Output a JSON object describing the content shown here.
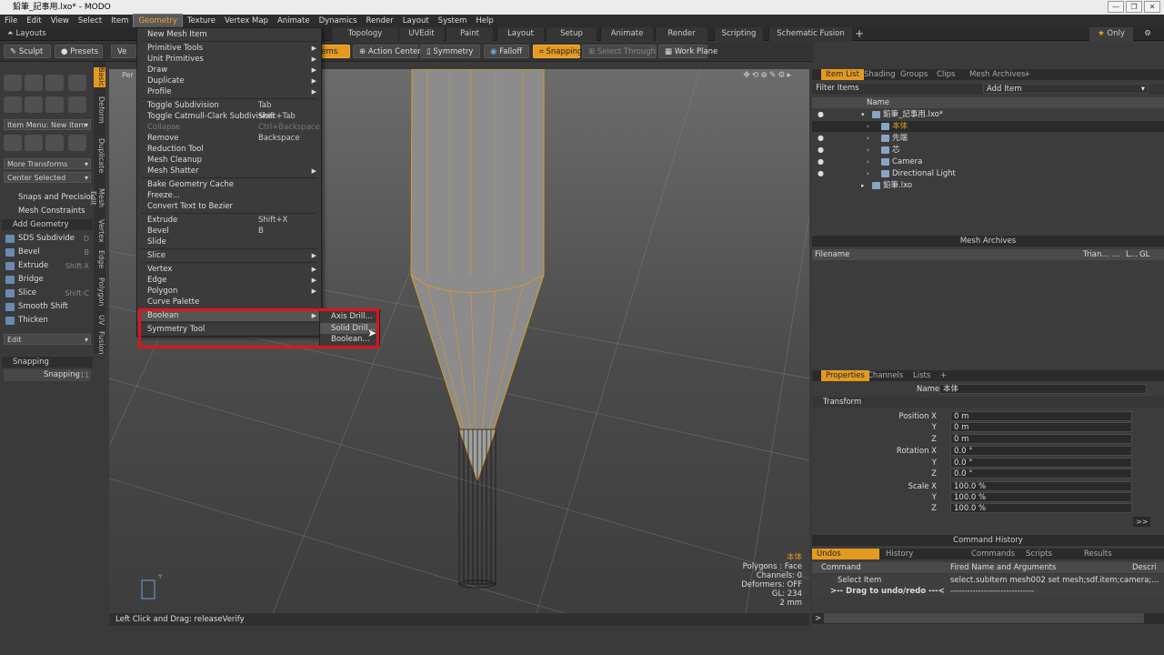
{
  "window": {
    "title": "鉛筆_記事用.lxo* - MODO",
    "min": "—",
    "restore": "❐",
    "close": "✕"
  },
  "menubar": [
    "File",
    "Edit",
    "View",
    "Select",
    "Item",
    "Geometry",
    "Texture",
    "Vertex Map",
    "Animate",
    "Dynamics",
    "Render",
    "Layout",
    "System",
    "Help"
  ],
  "layoutbar": {
    "label": "Layouts",
    "tabs": [
      "Topology",
      "UVEdit",
      "Paint",
      "Layout",
      "Setup",
      "Animate",
      "Render",
      "Scripting",
      "Schematic Fusion"
    ],
    "add": "+",
    "only_label": "Only"
  },
  "toolbar": {
    "sculpt": "Sculpt",
    "presets": "Presets",
    "ve": "Ve",
    "items": "tems",
    "action_center": "Action Center",
    "symmetry": "Symmetry",
    "falloff": "Falloff",
    "snapping": "Snapping",
    "select_through": "Select Through",
    "work_plane": "Work Plane"
  },
  "leftpanel": {
    "item_menu": "Item Menu: New Item",
    "more_transforms": "More Transforms",
    "center_selected": "Center Selected",
    "snaps": "Snaps and Precision",
    "mesh_constraints": "Mesh Constraints",
    "add_geometry": "Add Geometry",
    "tools": [
      {
        "label": "SDS Subdivide",
        "sc": "D"
      },
      {
        "label": "Bevel",
        "sc": "B"
      },
      {
        "label": "Extrude",
        "sc": "Shift-X"
      },
      {
        "label": "Bridge",
        "sc": ""
      },
      {
        "label": "Slice",
        "sc": "Shift-C"
      },
      {
        "label": "Smooth Shift",
        "sc": ""
      },
      {
        "label": "Thicken",
        "sc": ""
      }
    ],
    "edit": "Edit",
    "snapping_section": "Snapping",
    "snapping_btn": "Snapping",
    "snapping_sc": "F11"
  },
  "vtabs": [
    "Basic",
    "Deform",
    "Duplicate",
    "Mesh Edit",
    "Vertex",
    "Edge",
    "Polygon",
    "UV",
    "Fusion"
  ],
  "viewport": {
    "label": "Per",
    "selected": "本体",
    "polygons": "Polygons : Face",
    "channels": "Channels: 0",
    "deformers": "Deformers: OFF",
    "gl": "GL: 234",
    "scale": "2 mm",
    "axis_y": "Y"
  },
  "status": "Left Click and Drag:  releaseVerify",
  "geometry_menu": [
    {
      "label": "New Mesh Item",
      "sc": "",
      "arrow": false
    },
    {
      "sep": true
    },
    {
      "label": "Primitive Tools",
      "arrow": true
    },
    {
      "label": "Unit Primitives",
      "arrow": true
    },
    {
      "label": "Draw",
      "arrow": true
    },
    {
      "label": "Duplicate",
      "arrow": true
    },
    {
      "label": "Profile",
      "arrow": true
    },
    {
      "sep": true
    },
    {
      "label": "Toggle Subdivision",
      "sc": "Tab"
    },
    {
      "label": "Toggle Catmull-Clark Subdivision",
      "sc": "Shift+Tab"
    },
    {
      "label": "Collapse",
      "sc": "Ctrl+Backspace",
      "dis": true
    },
    {
      "label": "Remove",
      "sc": "Backspace"
    },
    {
      "label": "Reduction Tool"
    },
    {
      "label": "Mesh Cleanup"
    },
    {
      "label": "Mesh Shatter",
      "arrow": true
    },
    {
      "sep": true
    },
    {
      "label": "Bake Geometry Cache"
    },
    {
      "label": "Freeze..."
    },
    {
      "label": "Convert Text to Bezier"
    },
    {
      "sep": true
    },
    {
      "label": "Extrude",
      "sc": "Shift+X"
    },
    {
      "label": "Bevel",
      "sc": "B"
    },
    {
      "label": "Slide"
    },
    {
      "sep": true
    },
    {
      "label": "Slice",
      "arrow": true
    },
    {
      "sep": true
    },
    {
      "label": "Vertex",
      "arrow": true
    },
    {
      "label": "Edge",
      "arrow": true
    },
    {
      "label": "Polygon",
      "arrow": true
    },
    {
      "label": "Curve Palette"
    },
    {
      "sep": true
    },
    {
      "label": "Boolean",
      "arrow": true,
      "hl": true
    },
    {
      "sep": true
    },
    {
      "label": "Symmetry Tool"
    }
  ],
  "boolean_submenu": [
    "Axis Drill...",
    "Solid Drill...",
    "Boolean..."
  ],
  "item_list": {
    "tabs": [
      "Item List",
      "Shading",
      "Groups",
      "Clips",
      "Mesh Archives",
      "+"
    ],
    "filter": "Filter Items",
    "add_item": "Add Item",
    "col_name": "Name",
    "items": [
      {
        "label": "鉛筆_記事用.lxo*",
        "level": 0
      },
      {
        "label": "本体",
        "level": 1,
        "sel": true
      },
      {
        "label": "先端",
        "level": 1
      },
      {
        "label": "芯",
        "level": 1
      },
      {
        "label": "Camera",
        "level": 1
      },
      {
        "label": "Directional Light",
        "level": 1
      },
      {
        "label": "鉛筆.lxo",
        "level": 0
      }
    ]
  },
  "mesh_archives": {
    "title": "Mesh Archives",
    "col_filename": "Filename",
    "col_tri": "Trian...",
    "col_dots": "...",
    "col_l": "L...",
    "col_gl": "GL"
  },
  "properties": {
    "tabs": [
      "Properties",
      "Channels",
      "Lists",
      "+"
    ],
    "name_label": "Name",
    "name_value": "本体",
    "transform": "Transform",
    "rows": [
      {
        "label": "Position X",
        "value": "0 m"
      },
      {
        "label": "Y",
        "value": "0 m"
      },
      {
        "label": "Z",
        "value": "0 m"
      },
      {
        "label": "Rotation X",
        "value": "0.0 °"
      },
      {
        "label": "Y",
        "value": "0.0 °"
      },
      {
        "label": "Z",
        "value": "0.0 °"
      },
      {
        "label": "Scale X",
        "value": "100.0 %"
      },
      {
        "label": "Y",
        "value": "100.0 %"
      },
      {
        "label": "Z",
        "value": "100.0 %"
      }
    ],
    "more": ">>"
  },
  "command_history": {
    "title": "Command History",
    "tabs": [
      "Undos",
      "History",
      "Commands",
      "Scripts",
      "Results"
    ],
    "col_command": "Command",
    "col_fired": "Fired Name and Arguments",
    "col_desc": "Descri",
    "rows": [
      {
        "cmd": "Select Item",
        "fired": "select.subItem mesh002 set mesh;sdf.item;camera;..."
      },
      {
        "cmd": ">-- Drag to undo/redo ---<",
        "fired": "------------------------------"
      }
    ],
    "prompt": ">"
  },
  "accent": "#e39a1f"
}
